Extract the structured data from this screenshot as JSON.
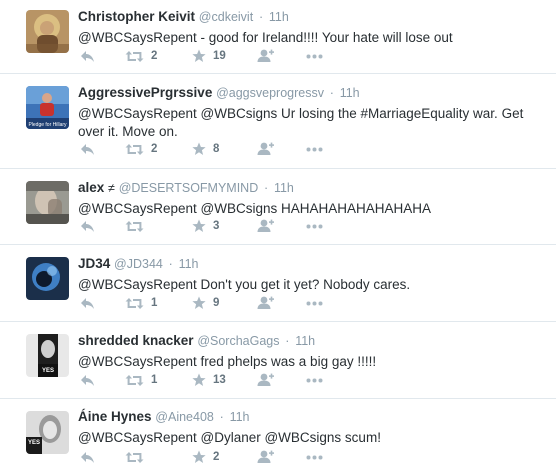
{
  "tweets": [
    {
      "name": "Christopher Keivit",
      "handle": "@cdkeivit",
      "time": "11h",
      "avatar": "religious-painting-avatar",
      "text": "@WBCSaysRepent - good for Ireland!!!!  Your hate will lose out",
      "retweets": "2",
      "favorites": "19"
    },
    {
      "name": "AggressivePrgrssive",
      "handle": "@aggsveprogressv",
      "time": "11h",
      "avatar": "hillary-campaign-avatar",
      "avatar_caption": "Pledge for Hillary",
      "text": "@WBCSaysRepent @WBCsigns Ur losing the #MarriageEquality war.  Get over it.  Move on.",
      "retweets": "2",
      "favorites": "8"
    },
    {
      "name": "alex",
      "badge": "≠",
      "handle": "@DESERTSOFMYMIND",
      "time": "11h",
      "avatar": "face-photo-avatar",
      "text": "@WBCSaysRepent @WBCsigns HAHAHAHAHAHAHAHA",
      "retweets": "",
      "favorites": "3"
    },
    {
      "name": "JD34",
      "handle": "@JD344",
      "time": "11h",
      "avatar": "blue-abstract-avatar",
      "text": "@WBCSaysRepent Don't you get it yet? Nobody cares.",
      "retweets": "1",
      "favorites": "9"
    },
    {
      "name": "shredded knacker",
      "handle": "@SorchaGags",
      "time": "11h",
      "avatar": "bw-portrait-avatar",
      "avatar_caption": "YES",
      "text": "@WBCSaysRepent fred phelps was a big gay !!!!!",
      "retweets": "1",
      "favorites": "13"
    },
    {
      "name": "Áine Hynes",
      "handle": "@Aine408",
      "time": "11h",
      "avatar": "bw-portrait-avatar",
      "avatar_caption": "YES",
      "text": "@WBCSaysRepent @Dylaner @WBCsigns scum!",
      "retweets": "",
      "favorites": "2"
    }
  ]
}
